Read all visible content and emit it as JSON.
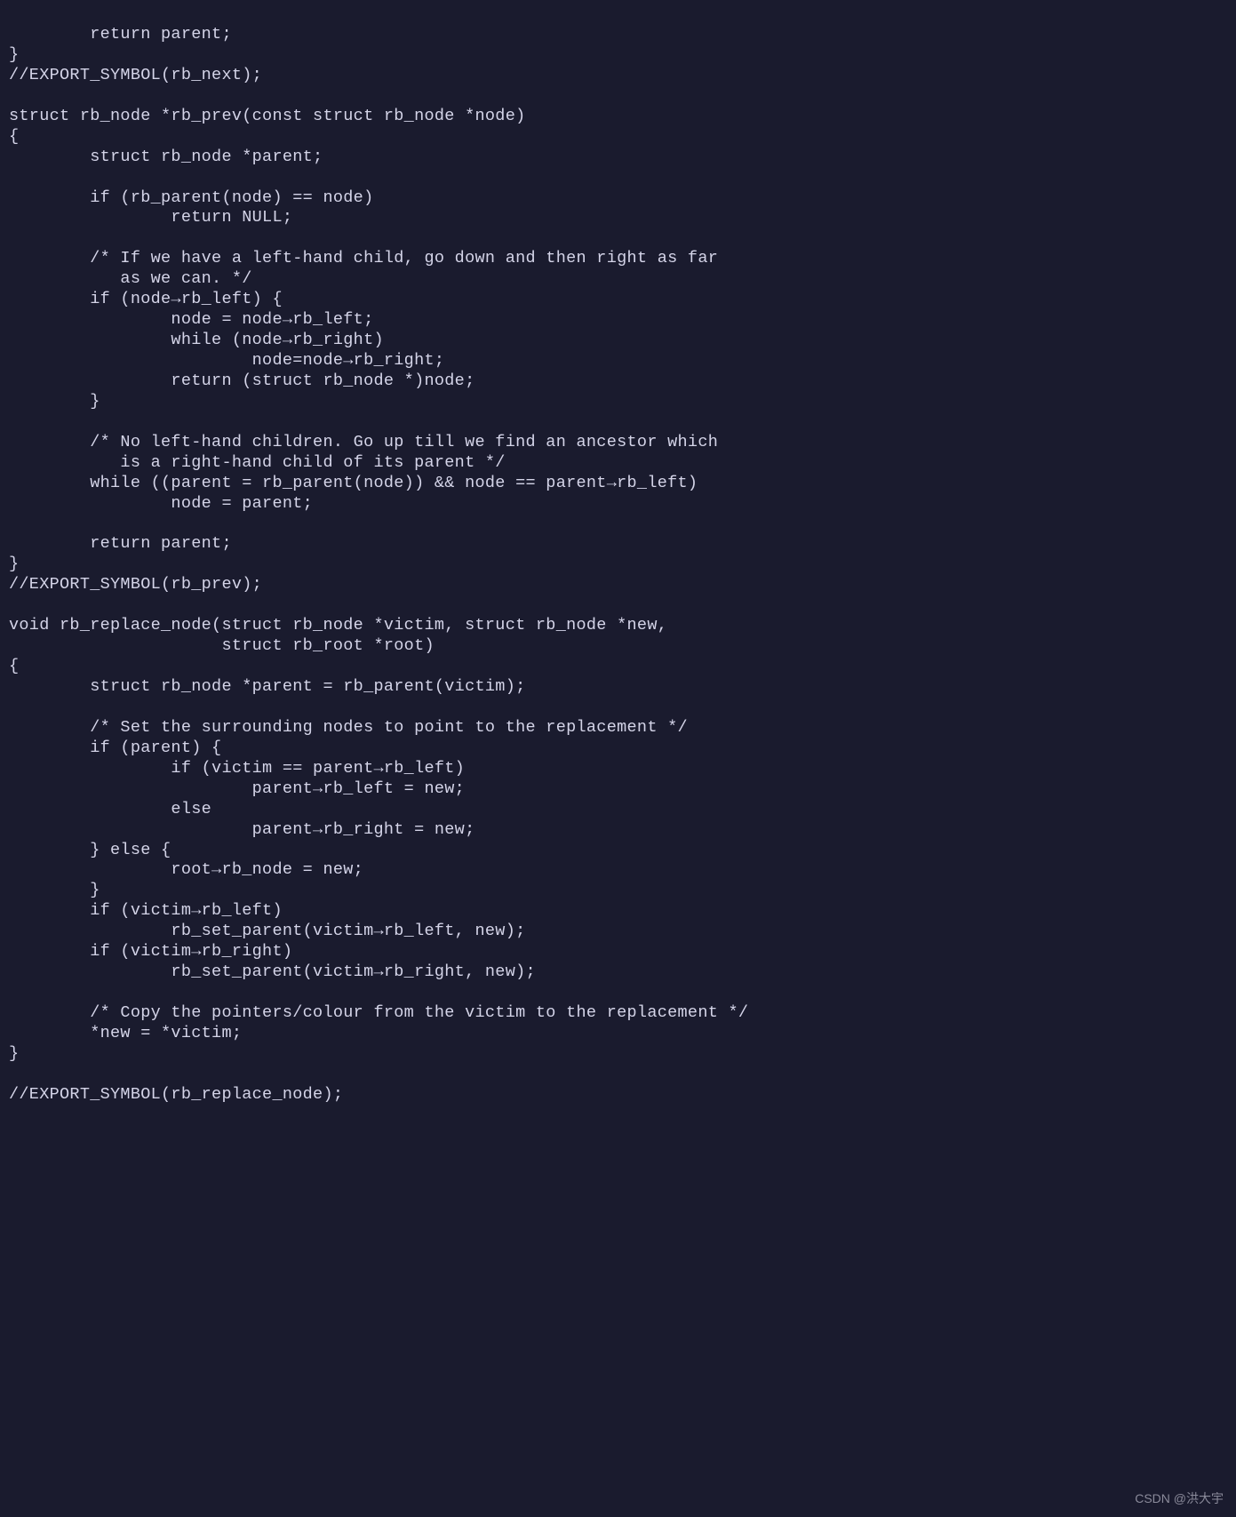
{
  "code": {
    "lines": [
      "        return parent;",
      "}",
      "//EXPORT_SYMBOL(rb_next);",
      "",
      "struct rb_node *rb_prev(const struct rb_node *node)",
      "{",
      "        struct rb_node *parent;",
      "",
      "        if (rb_parent(node) == node)",
      "                return NULL;",
      "",
      "        /* If we have a left-hand child, go down and then right as far",
      "           as we can. */",
      "        if (node->rb_left) {",
      "                node = node->rb_left;",
      "                while (node->rb_right)",
      "                        node=node->rb_right;",
      "                return (struct rb_node *)node;",
      "        }",
      "",
      "        /* No left-hand children. Go up till we find an ancestor which",
      "           is a right-hand child of its parent */",
      "        while ((parent = rb_parent(node)) && node == parent->rb_left)",
      "                node = parent;",
      "",
      "        return parent;",
      "}",
      "//EXPORT_SYMBOL(rb_prev);",
      "",
      "void rb_replace_node(struct rb_node *victim, struct rb_node *new,",
      "                     struct rb_root *root)",
      "{",
      "        struct rb_node *parent = rb_parent(victim);",
      "",
      "        /* Set the surrounding nodes to point to the replacement */",
      "        if (parent) {",
      "                if (victim == parent->rb_left)",
      "                        parent->rb_left = new;",
      "                else",
      "                        parent->rb_right = new;",
      "        } else {",
      "                root->rb_node = new;",
      "        }",
      "        if (victim->rb_left)",
      "                rb_set_parent(victim->rb_left, new);",
      "        if (victim->rb_right)",
      "                rb_set_parent(victim->rb_right, new);",
      "",
      "        /* Copy the pointers/colour from the victim to the replacement */",
      "        *new = *victim;",
      "}",
      "",
      "//EXPORT_SYMBOL(rb_replace_node);"
    ]
  },
  "watermark": "CSDN @洪大宇"
}
